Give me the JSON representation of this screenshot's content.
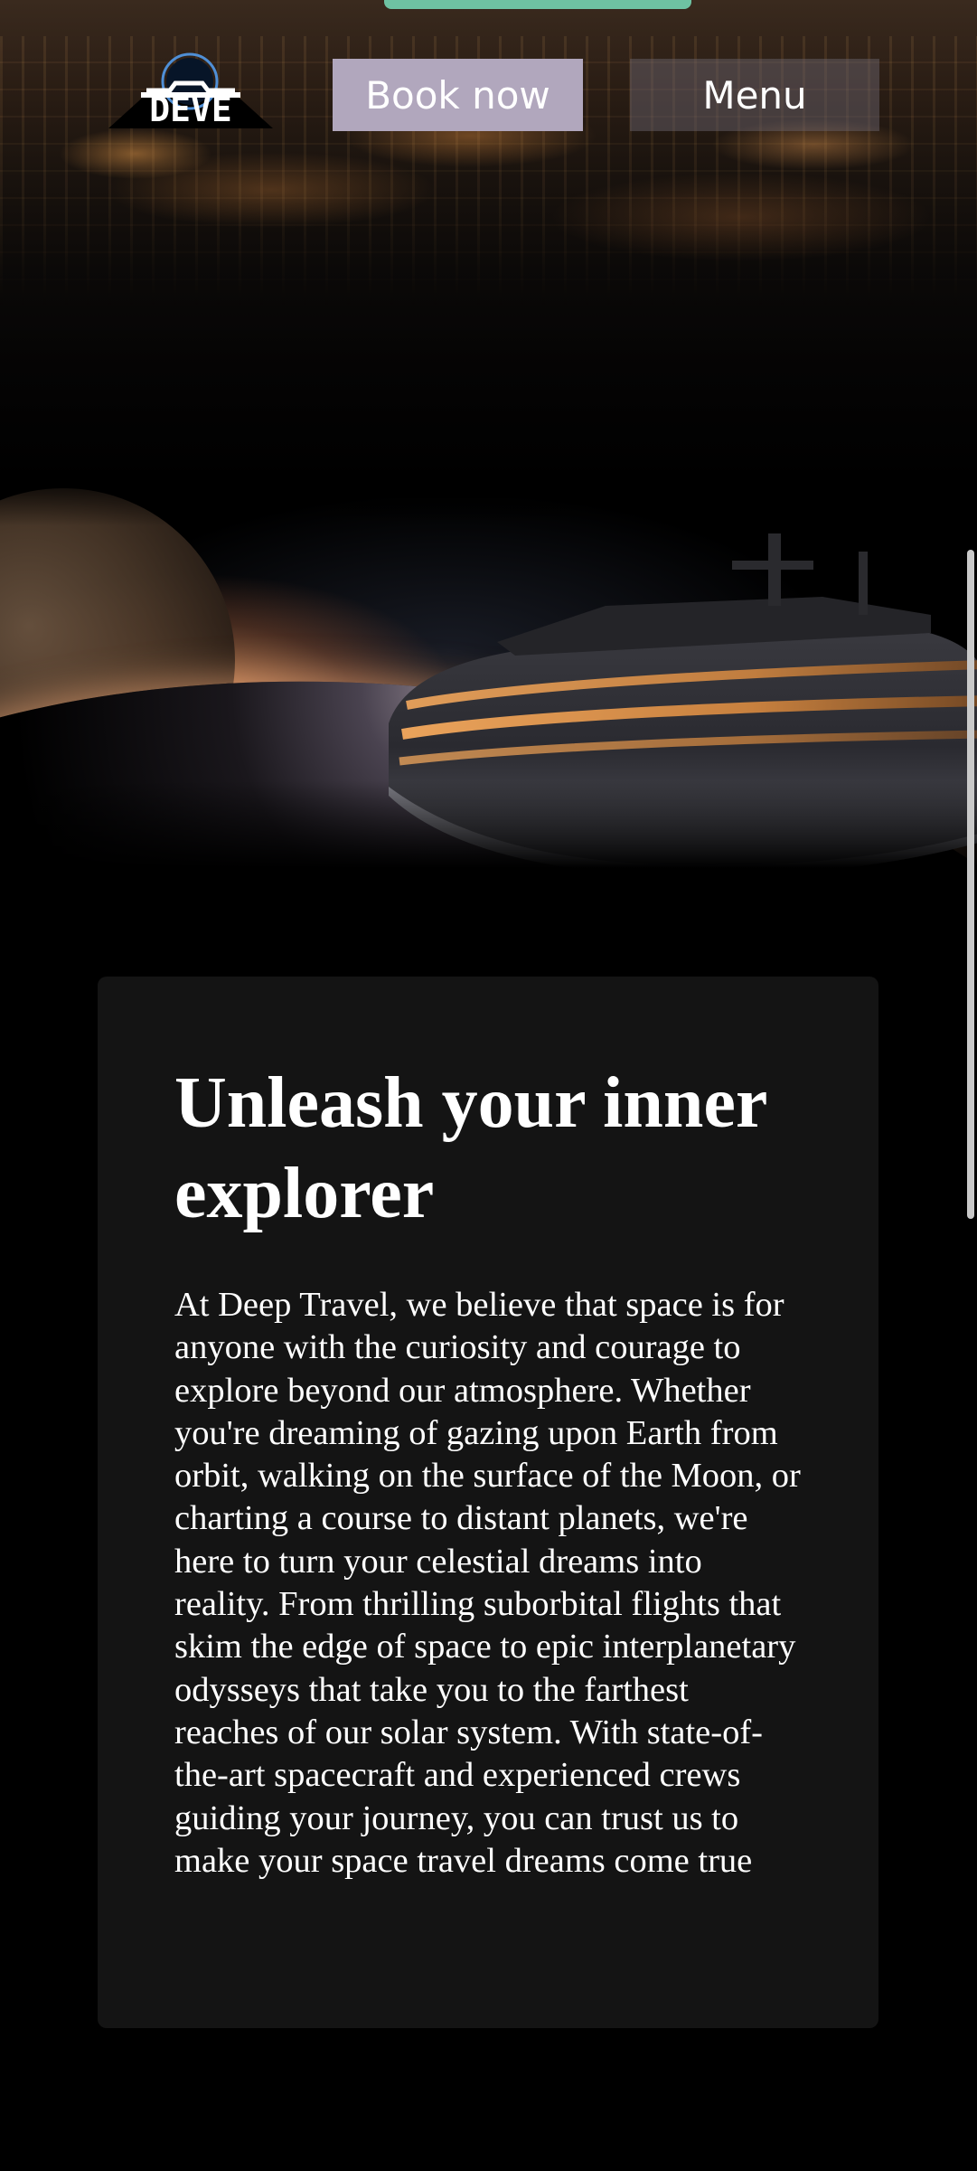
{
  "header": {
    "logo_alt": "Deep Travel",
    "book_label": "Book now",
    "menu_label": "Menu"
  },
  "intro": {
    "title": "Unleash your inner explorer",
    "body": "At Deep Travel, we believe that space is for anyone with the curiosity and courage to explore beyond our atmosphere. Whether you're dreaming of gazing upon Earth from orbit, walking on the surface of the Moon, or charting a course to distant planets, we're here to turn your celestial dreams into reality. From thrilling suborbital flights that skim the edge of space to epic interplanetary odysseys that take you to the farthest reaches of our solar system. With state-of-the-art spacecraft and experienced crews guiding your journey, you can trust us to make your space travel dreams come true"
  },
  "theme": {
    "book_button_color": "#b1a7bd",
    "top_strip_color": "#6ec2a2",
    "card_background": "#141414"
  },
  "icons": {
    "logo": "deep-travel-logo"
  }
}
